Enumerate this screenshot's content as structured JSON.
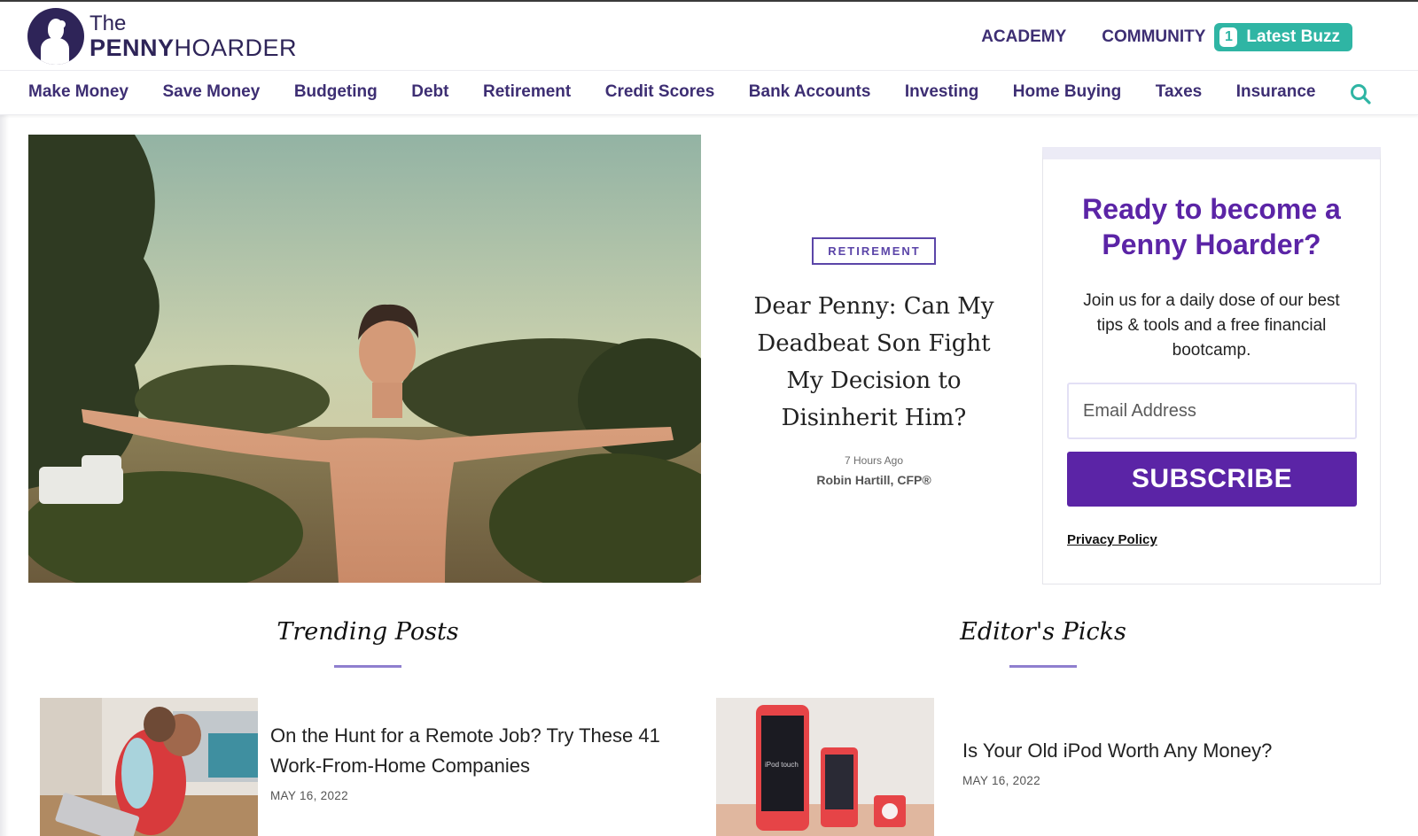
{
  "brand": {
    "logo_the": "The",
    "logo_penny": "PENNY",
    "logo_hoarder": "HOARDER"
  },
  "top_nav": {
    "academy": "ACADEMY",
    "community": "COMMUNITY",
    "buzz_count": "1",
    "buzz_label": "Latest Buzz"
  },
  "nav": {
    "items": [
      "Make Money",
      "Save Money",
      "Budgeting",
      "Debt",
      "Retirement",
      "Credit Scores",
      "Bank Accounts",
      "Investing",
      "Home Buying",
      "Taxes",
      "Insurance"
    ]
  },
  "featured": {
    "category": "RETIREMENT",
    "title": "Dear Penny: Can My Deadbeat Son Fight My Decision to Disinherit Him?",
    "time": "7 Hours Ago",
    "author": "Robin Hartill, CFP®"
  },
  "subscribe": {
    "title": "Ready to become a Penny Hoarder?",
    "description": "Join us for a daily dose of our best tips & tools and a free financial bootcamp.",
    "email_placeholder": "Email Address",
    "button_label": "SUBSCRIBE",
    "privacy_label": "Privacy Policy"
  },
  "sections": {
    "trending_title": "Trending Posts",
    "editors_title": "Editor's Picks"
  },
  "trending_article": {
    "title": "On the Hunt for a Remote Job? Try These 41 Work-From-Home Companies",
    "date": "MAY 16, 2022"
  },
  "editors_article": {
    "title": "Is Your Old iPod Worth Any Money?",
    "date": "MAY 16, 2022"
  },
  "thumb_text": {
    "ipod_screen": "iPod touch"
  },
  "colors": {
    "brand_dark": "#2e2458",
    "nav_text": "#3d2e73",
    "accent_purple": "#5b24a6",
    "buzz_teal": "#2fb5a4",
    "section_rule": "#8f7fcf"
  },
  "icons": {
    "search": "search-icon",
    "logo": "penny-silhouette-icon"
  }
}
